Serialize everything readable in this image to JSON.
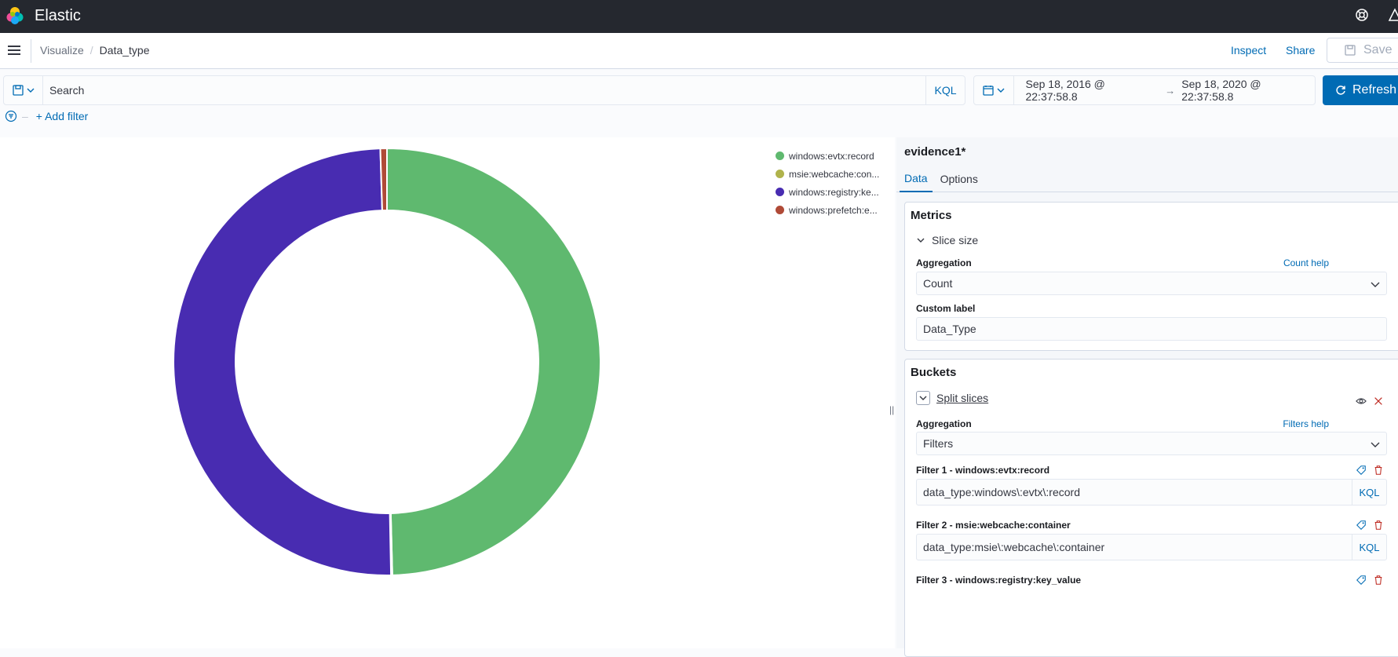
{
  "app": {
    "brand": "Elastic"
  },
  "nav": {
    "breadcrumbs": [
      "Visualize",
      "Data_type"
    ],
    "separator": "/",
    "inspect": "Inspect",
    "share": "Share",
    "save": "Save"
  },
  "query": {
    "placeholder": "Search",
    "language": "KQL",
    "date_start": "Sep 18, 2016 @ 22:37:58.8",
    "date_arrow": "→",
    "date_end": "Sep 18, 2020 @ 22:37:58.8",
    "refresh": "Refresh",
    "add_filter": "+ Add filter",
    "filter_dash": "–"
  },
  "chart_data": {
    "type": "pie",
    "donut": true,
    "legend_position": "top-right",
    "slices": [
      {
        "label": "windows:evtx:record",
        "display": "windows:evtx:record",
        "value": 49.6,
        "color": "#5fb96f"
      },
      {
        "label": "msie:webcache:container",
        "display": "msie:webcache:con...",
        "value": 0.1,
        "color": "#b0b34c"
      },
      {
        "label": "windows:registry:key_value",
        "display": "windows:registry:ke...",
        "value": 49.8,
        "color": "#482cb1"
      },
      {
        "label": "windows:prefetch:execution",
        "display": "windows:prefetch:e...",
        "value": 0.5,
        "color": "#b04a37"
      }
    ]
  },
  "sidebar": {
    "index": "evidence1*",
    "tabs": [
      "Data",
      "Options"
    ],
    "resize": "||",
    "metrics": {
      "title": "Metrics",
      "agg_title": "Slice size",
      "aggregation_label": "Aggregation",
      "aggregation_help": "Count help",
      "aggregation_value": "Count",
      "custom_label_label": "Custom label",
      "custom_label_value": "Data_Type"
    },
    "buckets": {
      "title": "Buckets",
      "agg_title": "Split slices",
      "aggregation_label": "Aggregation",
      "aggregation_help": "Filters help",
      "aggregation_value": "Filters",
      "filters": [
        {
          "label": "Filter 1 - windows:evtx:record",
          "query": "data_type:windows\\:evtx\\:record",
          "lang": "KQL"
        },
        {
          "label": "Filter 2 - msie:webcache:container",
          "query": "data_type:msie\\:webcache\\:container",
          "lang": "KQL"
        },
        {
          "label": "Filter 3 - windows:registry:key_value",
          "query": "",
          "lang": "KQL"
        }
      ]
    }
  },
  "colors": {
    "accent": "#006bb4",
    "header_bg": "#25282f",
    "danger": "#bd271e"
  }
}
